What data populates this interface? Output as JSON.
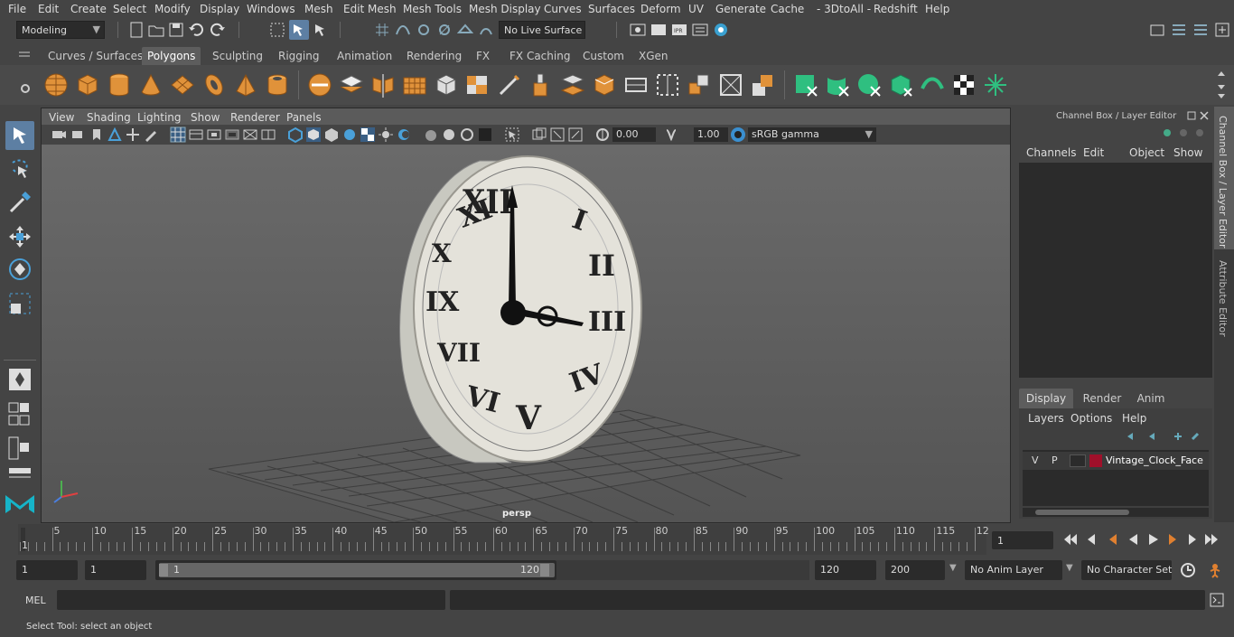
{
  "menubar": {
    "items": [
      "File",
      "Edit",
      "Create",
      "Select",
      "Modify",
      "Display",
      "Windows",
      "Mesh",
      "Edit Mesh",
      "Mesh Tools",
      "Mesh Display",
      "Curves",
      "Surfaces",
      "Deform",
      "UV",
      "Generate",
      "Cache",
      "- 3DtoAll -",
      "Redshift",
      "Help"
    ]
  },
  "status": {
    "mode": "Modeling",
    "live_surface": "No Live Surface"
  },
  "shelf": {
    "tabs": [
      "Curves / Surfaces",
      "Polygons",
      "Sculpting",
      "Rigging",
      "Animation",
      "Rendering",
      "FX",
      "FX Caching",
      "Custom",
      "XGen"
    ],
    "active": "Polygons"
  },
  "viewport": {
    "menus": [
      "View",
      "Shading",
      "Lighting",
      "Show",
      "Renderer",
      "Panels"
    ],
    "exposure": "0.00",
    "gamma": "1.00",
    "color_space": "sRGB gamma",
    "camera_label": "persp"
  },
  "channel_box": {
    "title": "Channel Box / Layer Editor",
    "menus": [
      "Channels",
      "Edit",
      "Object",
      "Show"
    ]
  },
  "layer_editor": {
    "tabs": [
      "Display",
      "Render",
      "Anim"
    ],
    "active_tab": "Display",
    "menus": [
      "Layers",
      "Options",
      "Help"
    ],
    "layer": {
      "v": "V",
      "p": "P",
      "name": "Vintage_Clock_Face",
      "color": "#a0102a"
    }
  },
  "side_tabs": {
    "channel": "Channel Box / Layer Editor",
    "attribute": "Attribute Editor"
  },
  "timeline": {
    "ticks": [
      "5",
      "10",
      "15",
      "20",
      "25",
      "30",
      "35",
      "40",
      "45",
      "50",
      "55",
      "60",
      "65",
      "70",
      "75",
      "80",
      "85",
      "90",
      "95",
      "100",
      "105",
      "110",
      "115",
      "12"
    ],
    "start_marker": "1",
    "current_frame": "1"
  },
  "range": {
    "start": "1",
    "anim_start": "1",
    "slider_start": "1",
    "slider_end": "120",
    "end": "120",
    "anim_end": "200",
    "anim_layer": "No Anim Layer",
    "char_set": "No Character Set"
  },
  "command": {
    "label": "MEL"
  },
  "help_line": {
    "text": "Select Tool: select an object"
  }
}
